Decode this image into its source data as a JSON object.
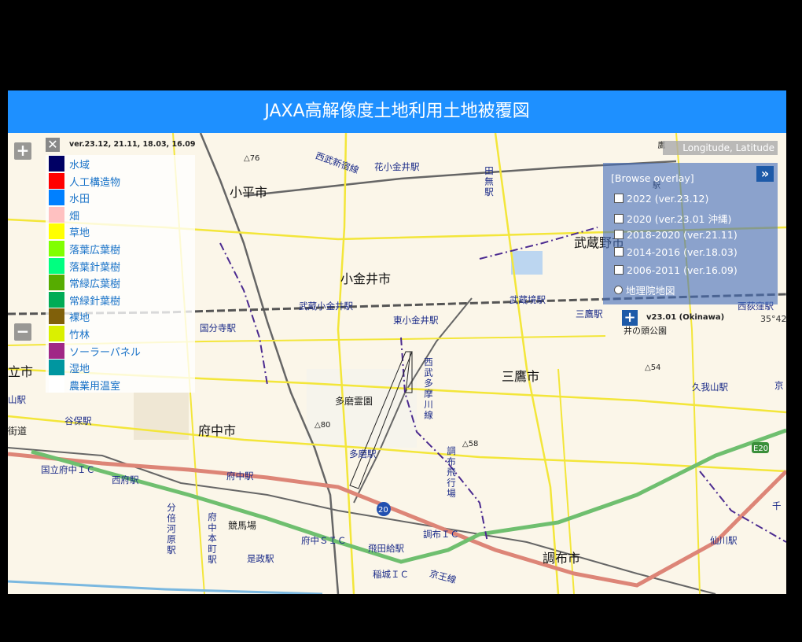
{
  "header": {
    "title": "JAXA高解像度土地利用土地被覆図"
  },
  "zoom": {
    "in_label": "+",
    "out_label": "−"
  },
  "legend": {
    "close_label": "✕",
    "version": "ver.23.12, 21.11, 18.03, 16.09",
    "items": [
      {
        "label": "水域",
        "color": "#000064"
      },
      {
        "label": "人工構造物",
        "color": "#ff0000"
      },
      {
        "label": "水田",
        "color": "#0080ff"
      },
      {
        "label": "畑",
        "color": "#ffc1c1"
      },
      {
        "label": "草地",
        "color": "#ffff00"
      },
      {
        "label": "落葉広葉樹",
        "color": "#80ff00"
      },
      {
        "label": "落葉針葉樹",
        "color": "#00ff80"
      },
      {
        "label": "常緑広葉樹",
        "color": "#56ac00"
      },
      {
        "label": "常緑針葉樹",
        "color": "#00ac56"
      },
      {
        "label": "裸地",
        "color": "#80600a"
      },
      {
        "label": "竹林",
        "color": "#daf000"
      },
      {
        "label": "ソーラーパネル",
        "color": "#a02886"
      },
      {
        "label": "湿地",
        "color": "#0096a0"
      },
      {
        "label": "農業用温室",
        "color": "#ffffff"
      }
    ]
  },
  "coords": {
    "label": "Longitude, Latitude"
  },
  "overlay": {
    "title": "[Browse overlay]",
    "collapse_label": "»",
    "options": [
      {
        "label": "2022 (ver.23.12)",
        "type": "checkbox"
      },
      {
        "label": "2020 (ver.23.01 沖縄)",
        "type": "checkbox"
      },
      {
        "label": "2018-2020 (ver.21.11)",
        "type": "checkbox"
      },
      {
        "label": "2014-2016 (ver.18.03)",
        "type": "checkbox"
      },
      {
        "label": "2006-2011 (ver.16.09)",
        "type": "checkbox"
      },
      {
        "label": "地理院地図",
        "type": "radio"
      }
    ],
    "sub_plus": "+",
    "sub_version": "v23.01 (Okinawa)",
    "partial_coord": "35°42"
  },
  "map_labels": {
    "cities": [
      "小平市",
      "小金井市",
      "武蔵野市",
      "三鷹市",
      "府中市",
      "調布市",
      "立市"
    ],
    "stations": [
      "花小金井駅",
      "武蔵小金井駅",
      "東小金井駅",
      "武蔵境駅",
      "三鷹駅",
      "国分寺駅",
      "西武多摩川線",
      "多磨駅",
      "谷保駅",
      "西府駅",
      "府中駅",
      "国立府中ＩＣ",
      "府中ＳＩＣ",
      "飛田給駅",
      "調布ＩＣ",
      "稲城ＩＣ",
      "是政駅",
      "久我山駅",
      "仙川駅",
      "西荻窪駅",
      "田無駅",
      "分倍河原駅",
      "府中本町駅",
      "調布飛行場",
      "西武新宿線",
      "京王線",
      "山駅",
      "千",
      "京"
    ],
    "places": [
      "多磨霊園",
      "競馬場",
      "井の頭公園",
      "△76",
      "△80",
      "△58",
      "△54",
      "街道",
      "E20",
      "20",
      "鷹",
      "駅"
    ]
  }
}
